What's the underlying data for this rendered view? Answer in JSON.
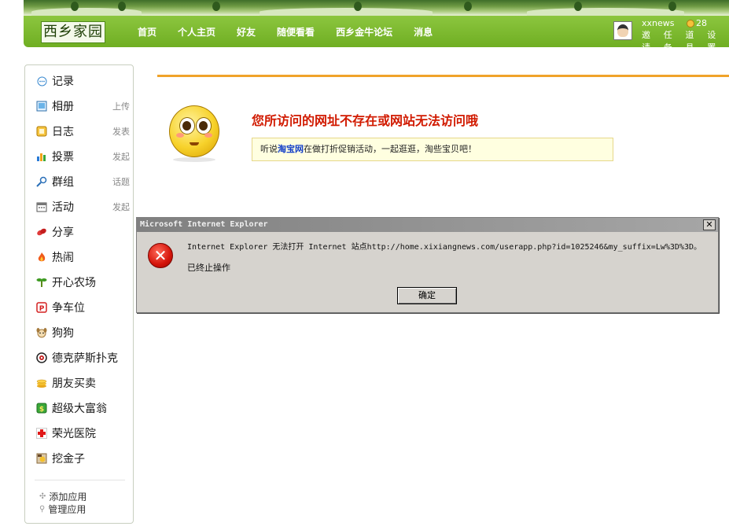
{
  "nav": {
    "logo": "西乡家园",
    "links": [
      "首页",
      "个人主页",
      "好友",
      "随便看看",
      "西乡金牛论坛",
      "消息"
    ],
    "user": {
      "name": "xxnews",
      "coins": "28",
      "links": [
        "邀请",
        "任务",
        "道具",
        "设置"
      ]
    }
  },
  "sidebar": {
    "items": [
      {
        "label": "记录",
        "action": "",
        "icon": "chat-bubble-icon"
      },
      {
        "label": "相册",
        "action": "上传",
        "icon": "photo-icon"
      },
      {
        "label": "日志",
        "action": "发表",
        "icon": "notebook-icon"
      },
      {
        "label": "投票",
        "action": "发起",
        "icon": "bar-chart-icon"
      },
      {
        "label": "群组",
        "action": "话题",
        "icon": "group-icon"
      },
      {
        "label": "活动",
        "action": "发起",
        "icon": "calendar-icon"
      },
      {
        "label": "分享",
        "action": "",
        "icon": "share-icon"
      },
      {
        "label": "热闹",
        "action": "",
        "icon": "fire-icon"
      },
      {
        "label": "开心农场",
        "action": "",
        "icon": "sprout-icon"
      },
      {
        "label": "争车位",
        "action": "",
        "icon": "parking-icon"
      },
      {
        "label": "狗狗",
        "action": "",
        "icon": "dog-icon"
      },
      {
        "label": "德克萨斯扑克",
        "action": "",
        "icon": "poker-icon"
      },
      {
        "label": "朋友买卖",
        "action": "",
        "icon": "coins-icon"
      },
      {
        "label": "超级大富翁",
        "action": "",
        "icon": "money-icon"
      },
      {
        "label": "荣光医院",
        "action": "",
        "icon": "red-cross-icon"
      },
      {
        "label": "挖金子",
        "action": "",
        "icon": "gold-pan-icon"
      }
    ],
    "add_app": "添加应用",
    "manage_app": "管理应用"
  },
  "main": {
    "error_title": "您所访问的网址不存在或网站无法访问哦",
    "notice_prefix": "听说",
    "notice_link": "淘宝网",
    "notice_suffix": "在做打折促销活动，一起逛逛，淘些宝贝吧！"
  },
  "dialog": {
    "title": "Microsoft Internet Explorer",
    "message": "Internet Explorer 无法打开 Internet 站点http://home.xixiangnews.com/userapp.php?id=1025246&my_suffix=Lw%3D%3D。",
    "message2": "已终止操作",
    "ok_label": "确定",
    "close_glyph": "✕"
  },
  "colors": {
    "nav_green": "#78b52a",
    "orange_line": "#f0a32a",
    "error_red": "#d11a00",
    "link_blue": "#1540c8"
  }
}
